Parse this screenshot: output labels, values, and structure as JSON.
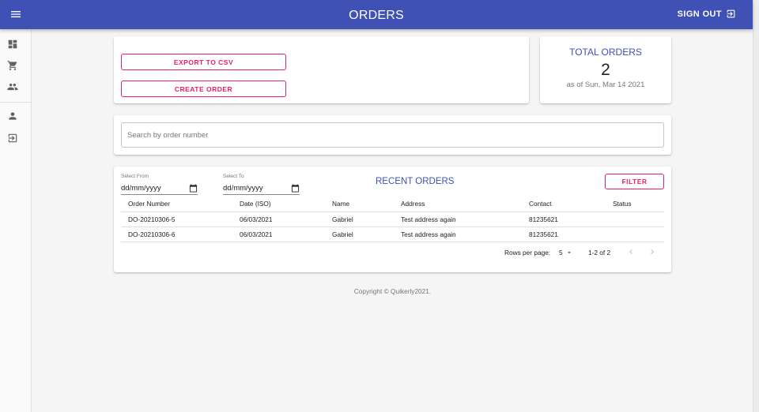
{
  "appbar": {
    "title": "ORDERS",
    "signout_label": "SIGN OUT"
  },
  "drawer": {
    "icons": [
      "dashboard-icon",
      "cart-icon",
      "people-icon",
      "person-icon",
      "exit-icon"
    ]
  },
  "actions": {
    "export_label": "EXPORT TO CSV",
    "create_label": "CREATE ORDER"
  },
  "total": {
    "title": "TOTAL ORDERS",
    "value": "2",
    "subtitle": "as of Sun, Mar 14 2021"
  },
  "search": {
    "placeholder": "Search by order number",
    "value": ""
  },
  "recent": {
    "title": "RECENT ORDERS",
    "from_label": "Select From",
    "to_label": "Select To",
    "from_value": "dd/mm/yyyy",
    "to_value": "dd/mm/yyyy",
    "filter_label": "FILTER",
    "columns": [
      "Order Number",
      "Date (ISO)",
      "Name",
      "Address",
      "Contact",
      "Status"
    ],
    "rows": [
      [
        "DO-20210306-5",
        "06/03/2021",
        "Gabriel",
        "Test address again",
        "81235621",
        ""
      ],
      [
        "DO-20210306-6",
        "06/03/2021",
        "Gabriel",
        "Test address again",
        "81235621",
        ""
      ]
    ],
    "pagination": {
      "rows_per_page_label": "Rows per page:",
      "rows_per_page": "5",
      "range": "1-2 of 2"
    }
  },
  "footer": {
    "copyright": "Copyright © Quikerly2021."
  },
  "colors": {
    "primary": "#3f51b5",
    "accent": "#e91e63",
    "background": "#f5f5f5"
  }
}
